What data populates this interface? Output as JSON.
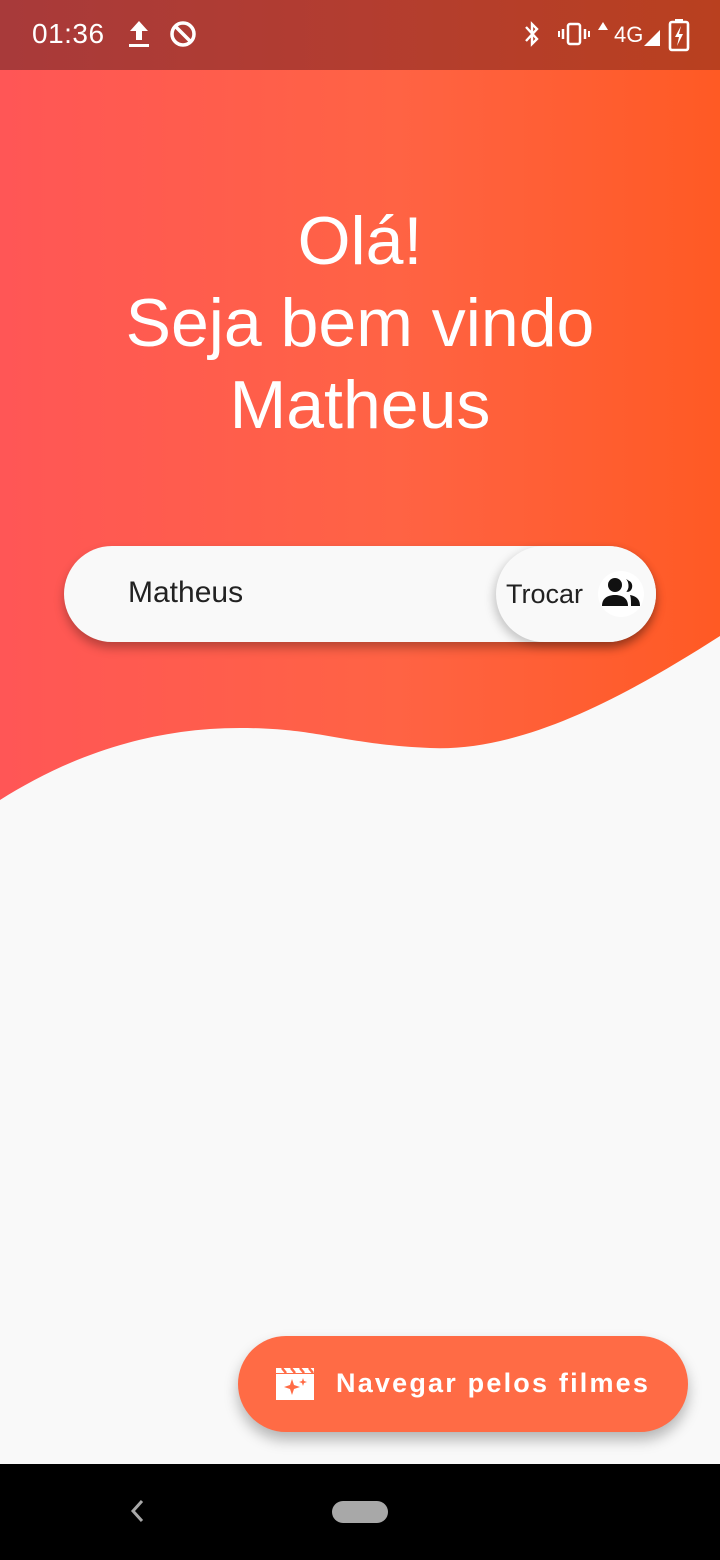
{
  "status_bar": {
    "time": "01:36",
    "network": "4G",
    "icons": [
      "upload-icon",
      "do-not-disturb-icon",
      "bluetooth-icon",
      "vibrate-icon",
      "signal-icon",
      "battery-charging-icon"
    ]
  },
  "greeting": {
    "line1": "Olá!",
    "line2": "Seja bem vindo",
    "line3": "Matheus"
  },
  "user_field": {
    "value": "Matheus",
    "swap_label": "Trocar",
    "swap_icon": "switch-account-icon"
  },
  "fab": {
    "label": "Navegar pelos filmes",
    "icon": "movie-filter-icon"
  },
  "navigation": {
    "back_icon": "back-icon",
    "home_icon": "home-pill-icon"
  },
  "colors": {
    "gradient_start": "#ff5656",
    "gradient_end": "#ff5a24",
    "fab": "#ff6b45",
    "background": "#f9f9f9"
  }
}
